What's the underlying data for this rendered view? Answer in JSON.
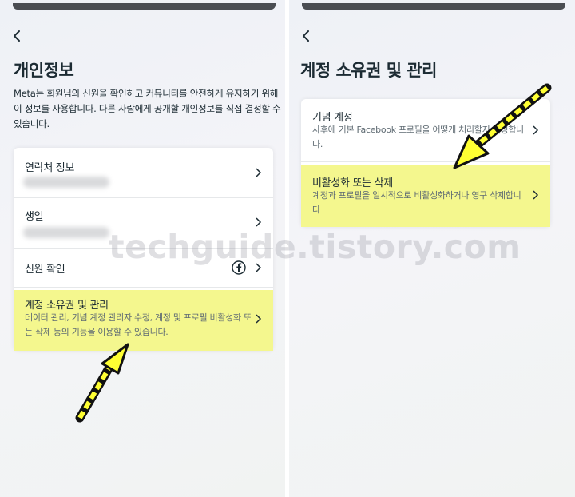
{
  "left": {
    "title": "개인정보",
    "description": "Meta는 회원님의 신원을 확인하고 커뮤니티를 안전하게 유지하기 위해 이 정보를 사용합니다. 다른 사람에게 공개할 개인정보를 직접 결정할 수 있습니다.",
    "items": [
      {
        "label": "연락처 정보"
      },
      {
        "label": "생일"
      },
      {
        "label": "신원 확인",
        "icon": "facebook-icon"
      },
      {
        "label": "계정 소유권 및 관리",
        "sub": "데이터 관리, 기념 계정 관리자 수정, 계정 및 프로필 비활성화 또는 삭제 등의 기능을 이용할 수 있습니다."
      }
    ]
  },
  "right": {
    "title": "계정 소유권 및 관리",
    "items": [
      {
        "label": "기념 계정",
        "sub": "사후에 기본 Facebook 프로필을 어떻게 처리할지 결정합니다."
      },
      {
        "label": "비활성화 또는 삭제",
        "sub": "계정과 프로필을 일시적으로 비활성화하거나 영구 삭제합니다"
      }
    ]
  },
  "watermark": "techguide.tistory.com",
  "colors": {
    "highlight": "#f4f78e",
    "arrow": "#ffff33"
  }
}
